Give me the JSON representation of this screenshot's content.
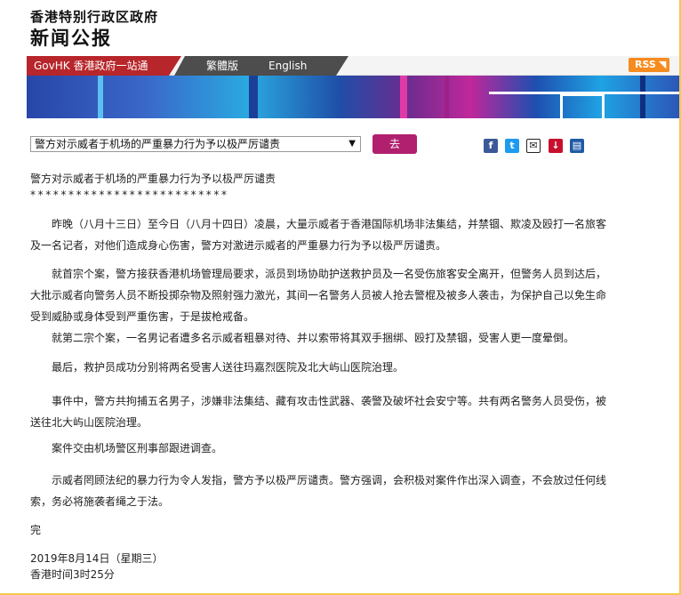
{
  "header": {
    "gov_title": "香港特别行政区政府",
    "press_title": "新闻公报"
  },
  "nav": {
    "govhk": "GovHK 香港政府一站通",
    "traditional": "繁體版",
    "english": "English",
    "rss": "RSS"
  },
  "selector": {
    "selected": "警方对示威者于机场的严重暴力行为予以极严厉谴责",
    "go_label": "去"
  },
  "share": {
    "facebook": "f",
    "twitter": "t",
    "mail": "✉",
    "bookmark": "↓",
    "print": "▤"
  },
  "article": {
    "headline": "警方对示威者于机场的严重暴力行为予以极严厉谴责",
    "stars": "**************************",
    "paragraphs": [
      "昨晚（八月十三日）至今日（八月十四日）凌晨，大量示威者于香港国际机场非法集结，并禁锢、欺凌及殴打一名旅客及一名记者，对他们造成身心伤害，警方对激进示威者的严重暴力行为予以极严厉谴责。",
      "就首宗个案，警方接获香港机场管理局要求，派员到场协助护送救护员及一名受伤旅客安全离开，但警务人员到达后，大批示威者向警务人员不断投掷杂物及照射强力激光，其间一名警务人员被人抢去警棍及被多人袭击，为保护自己以免生命受到威胁或身体受到严重伤害，于是拔枪戒备。",
      "就第二宗个案，一名男记者遭多名示威者粗暴对待、并以索带将其双手捆绑、殴打及禁锢，受害人更一度晕倒。",
      "最后，救护员成功分别将两名受害人送往玛嘉烈医院及北大屿山医院治理。",
      "事件中，警方共拘捕五名男子，涉嫌非法集结、藏有攻击性武器、袭警及破坏社会安宁等。共有两名警务人员受伤，被送往北大屿山医院治理。",
      "案件交由机场警区刑事部跟进调查。",
      "示威者罔顾法纪的暴力行为令人发指，警方予以极严厉谴责。警方强调，会积极对案件作出深入调查，不会放过任何线索，务必将施袭者绳之于法。"
    ],
    "end_mark": "完",
    "date": "2019年8月14日（星期三）",
    "time": "香港时间3时25分"
  }
}
